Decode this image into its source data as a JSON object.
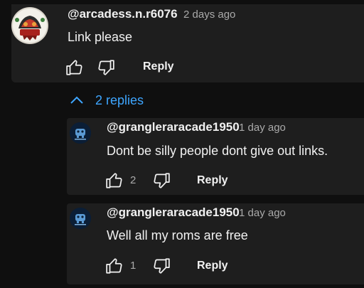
{
  "main_comment": {
    "handle": "@arcadess.n.r6076",
    "time": "2 days ago",
    "text": "Link please",
    "reply_label": "Reply",
    "avatar_text": "ARCADE"
  },
  "replies_toggle": {
    "label": "2 replies"
  },
  "replies": [
    {
      "handle": "@grangleraracade1950",
      "time": "1 day ago",
      "text": "Dont be silly people dont give out links.",
      "like_count": "2",
      "reply_label": "Reply"
    },
    {
      "handle": "@grangleraracade1950",
      "time": "1 day ago",
      "text": "Well  all my roms are free",
      "like_count": "1",
      "reply_label": "Reply"
    }
  ],
  "colors": {
    "background": "#0f0f0f",
    "card": "#1e1e1e",
    "link_blue": "#3ea6ff",
    "muted": "#aaaaaa"
  }
}
